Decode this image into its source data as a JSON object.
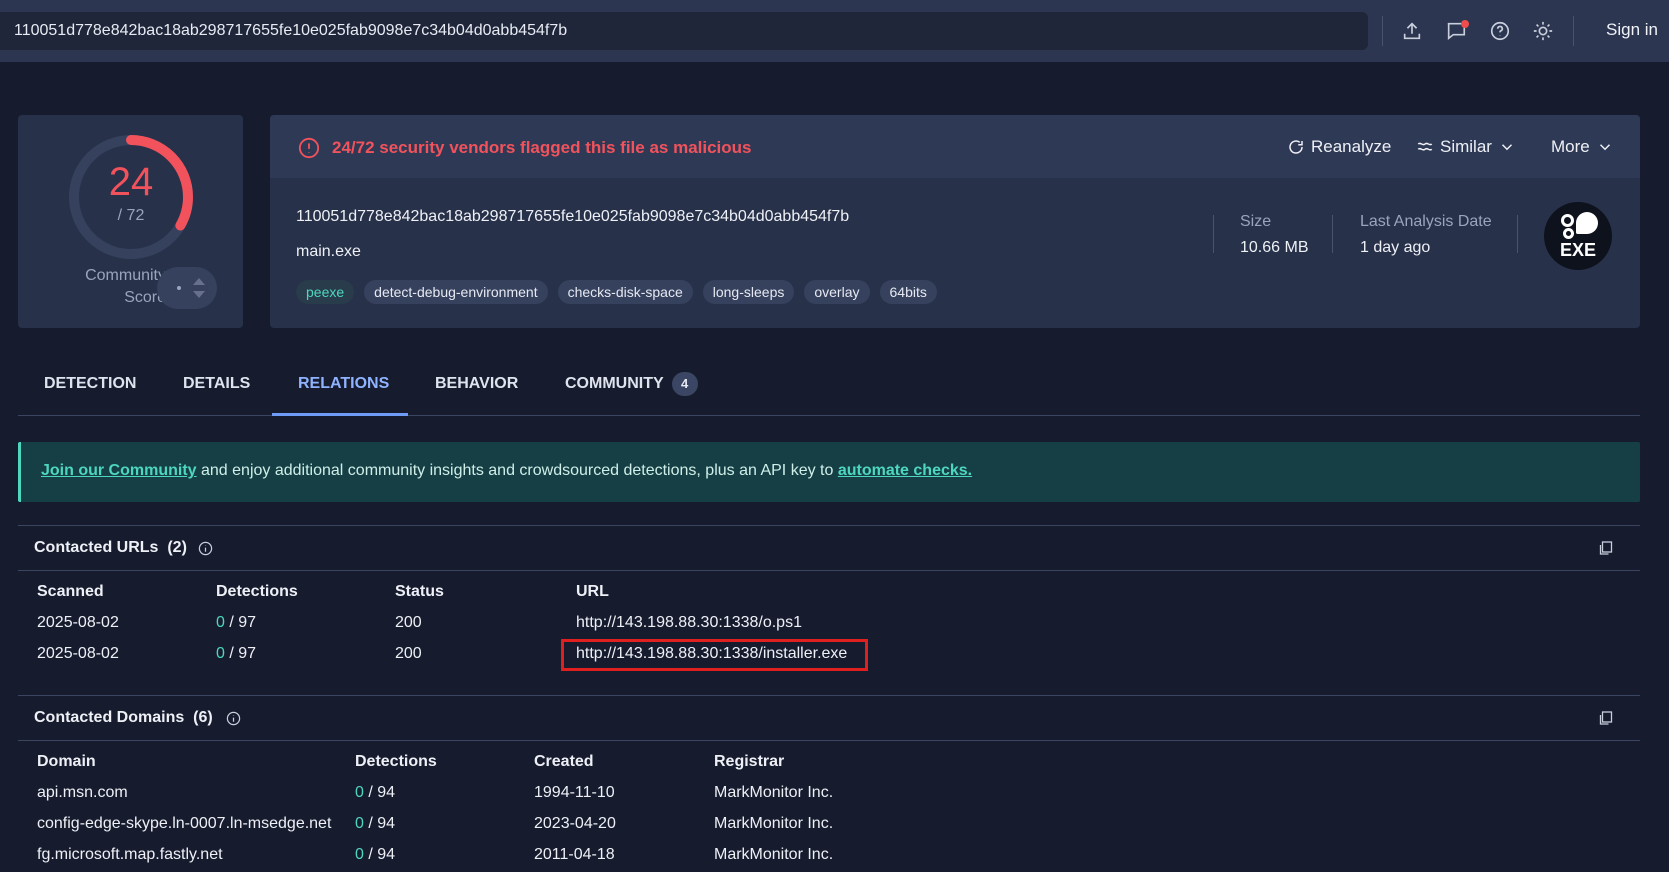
{
  "search": {
    "value": "110051d778e842bac18ab298717655fe10e025fab9098e7c34b04d0abb454f7b"
  },
  "header": {
    "sign_in": "Sign in"
  },
  "score": {
    "positives": "24",
    "total": "/ 72",
    "fraction_flagged": 0.333,
    "community_label_1": "Community",
    "community_label_2": "Score"
  },
  "summary": {
    "alert": "24/72 security vendors flagged this file as malicious",
    "actions": {
      "reanalyze": "Reanalyze",
      "similar": "Similar",
      "more": "More"
    },
    "hash": "110051d778e842bac18ab298717655fe10e025fab9098e7c34b04d0abb454f7b",
    "filename": "main.exe",
    "tags": [
      "peexe",
      "detect-debug-environment",
      "checks-disk-space",
      "long-sleeps",
      "overlay",
      "64bits"
    ],
    "size_label": "Size",
    "size_value": "10.66 MB",
    "date_label": "Last Analysis Date",
    "date_value": "1 day ago",
    "file_type_badge": "EXE"
  },
  "tabs": [
    {
      "label": "DETECTION"
    },
    {
      "label": "DETAILS"
    },
    {
      "label": "RELATIONS",
      "active": true
    },
    {
      "label": "BEHAVIOR"
    },
    {
      "label": "COMMUNITY",
      "badge": "4"
    }
  ],
  "banner": {
    "link1": "Join our Community",
    "middle": " and enjoy additional community insights and crowdsourced detections, plus an API key to ",
    "link2": "automate checks."
  },
  "contacted_urls": {
    "title": "Contacted URLs",
    "count": "(2)",
    "headers": {
      "scanned": "Scanned",
      "detections": "Detections",
      "status": "Status",
      "url": "URL"
    },
    "rows": [
      {
        "scanned": "2025-08-02",
        "det": "0",
        "total": " / 97",
        "status": "200",
        "url": "http://143.198.88.30:1338/o.ps1"
      },
      {
        "scanned": "2025-08-02",
        "det": "0",
        "total": " / 97",
        "status": "200",
        "url": "http://143.198.88.30:1338/installer.exe"
      }
    ]
  },
  "contacted_domains": {
    "title": "Contacted Domains",
    "count": "(6)",
    "headers": {
      "domain": "Domain",
      "detections": "Detections",
      "created": "Created",
      "registrar": "Registrar"
    },
    "rows": [
      {
        "domain": "api.msn.com",
        "det": "0",
        "total": " / 94",
        "created": "1994-11-10",
        "registrar": "MarkMonitor Inc."
      },
      {
        "domain": "config-edge-skype.ln-0007.ln-msedge.net",
        "det": "0",
        "total": " / 94",
        "created": "2023-04-20",
        "registrar": "MarkMonitor Inc."
      },
      {
        "domain": "fg.microsoft.map.fastly.net",
        "det": "0",
        "total": " / 94",
        "created": "2011-04-18",
        "registrar": "MarkMonitor Inc."
      }
    ]
  },
  "colors": {
    "malicious": "#f2525c",
    "accent": "#4ed7c0",
    "tab_active": "#8fb3ff",
    "highlight": "#e01f1f"
  }
}
